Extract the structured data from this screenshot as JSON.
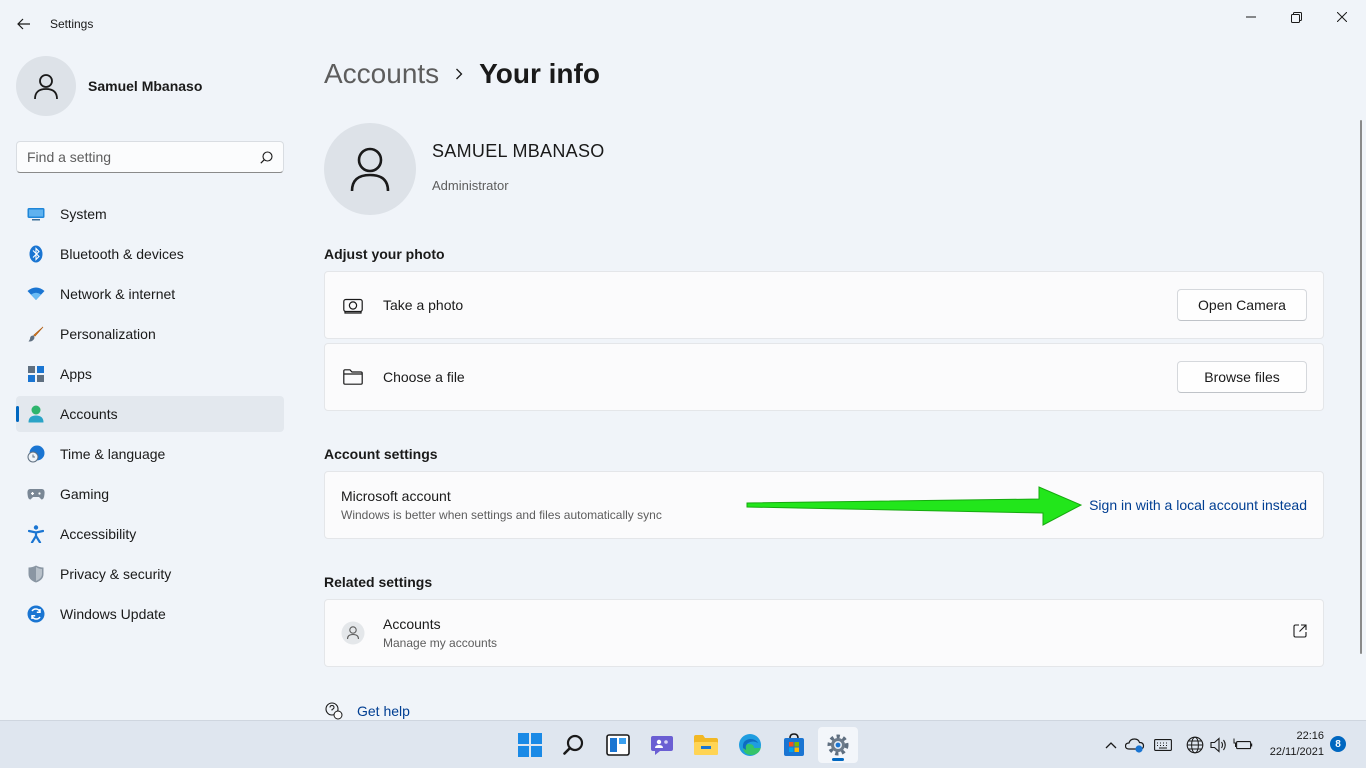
{
  "window": {
    "title": "Settings"
  },
  "profile": {
    "name": "Samuel Mbanaso"
  },
  "search": {
    "placeholder": "Find a setting"
  },
  "sidebar": {
    "items": [
      {
        "label": "System",
        "icon": "monitor-icon"
      },
      {
        "label": "Bluetooth & devices",
        "icon": "bluetooth-icon"
      },
      {
        "label": "Network & internet",
        "icon": "wifi-icon"
      },
      {
        "label": "Personalization",
        "icon": "brush-icon"
      },
      {
        "label": "Apps",
        "icon": "apps-icon"
      },
      {
        "label": "Accounts",
        "icon": "person-icon",
        "active": true
      },
      {
        "label": "Time & language",
        "icon": "clock-globe-icon"
      },
      {
        "label": "Gaming",
        "icon": "gamepad-icon"
      },
      {
        "label": "Accessibility",
        "icon": "accessibility-icon"
      },
      {
        "label": "Privacy & security",
        "icon": "shield-icon"
      },
      {
        "label": "Windows Update",
        "icon": "update-icon"
      }
    ]
  },
  "breadcrumb": {
    "parent": "Accounts",
    "current": "Your info"
  },
  "user": {
    "name": "SAMUEL MBANASO",
    "role": "Administrator"
  },
  "adjust_photo": {
    "heading": "Adjust your photo",
    "take_photo_label": "Take a photo",
    "take_photo_button": "Open Camera",
    "choose_file_label": "Choose a file",
    "choose_file_button": "Browse files"
  },
  "account_settings": {
    "heading": "Account settings",
    "title": "Microsoft account",
    "subtitle": "Windows is better when settings and files automatically sync",
    "link": "Sign in with a local account instead"
  },
  "related_settings": {
    "heading": "Related settings",
    "title": "Accounts",
    "subtitle": "Manage my accounts"
  },
  "help": {
    "label": "Get help"
  },
  "taskbar": {
    "apps": [
      "windows-start-icon",
      "search-icon",
      "widgets-icon",
      "chat-icon",
      "file-explorer-icon",
      "edge-icon",
      "store-icon",
      "settings-icon"
    ],
    "time": "22:16",
    "date": "22/11/2021",
    "notifications": "8"
  },
  "colors": {
    "accent": "#0067c0",
    "link": "#003e92",
    "annotation_arrow": "#22e61b"
  }
}
